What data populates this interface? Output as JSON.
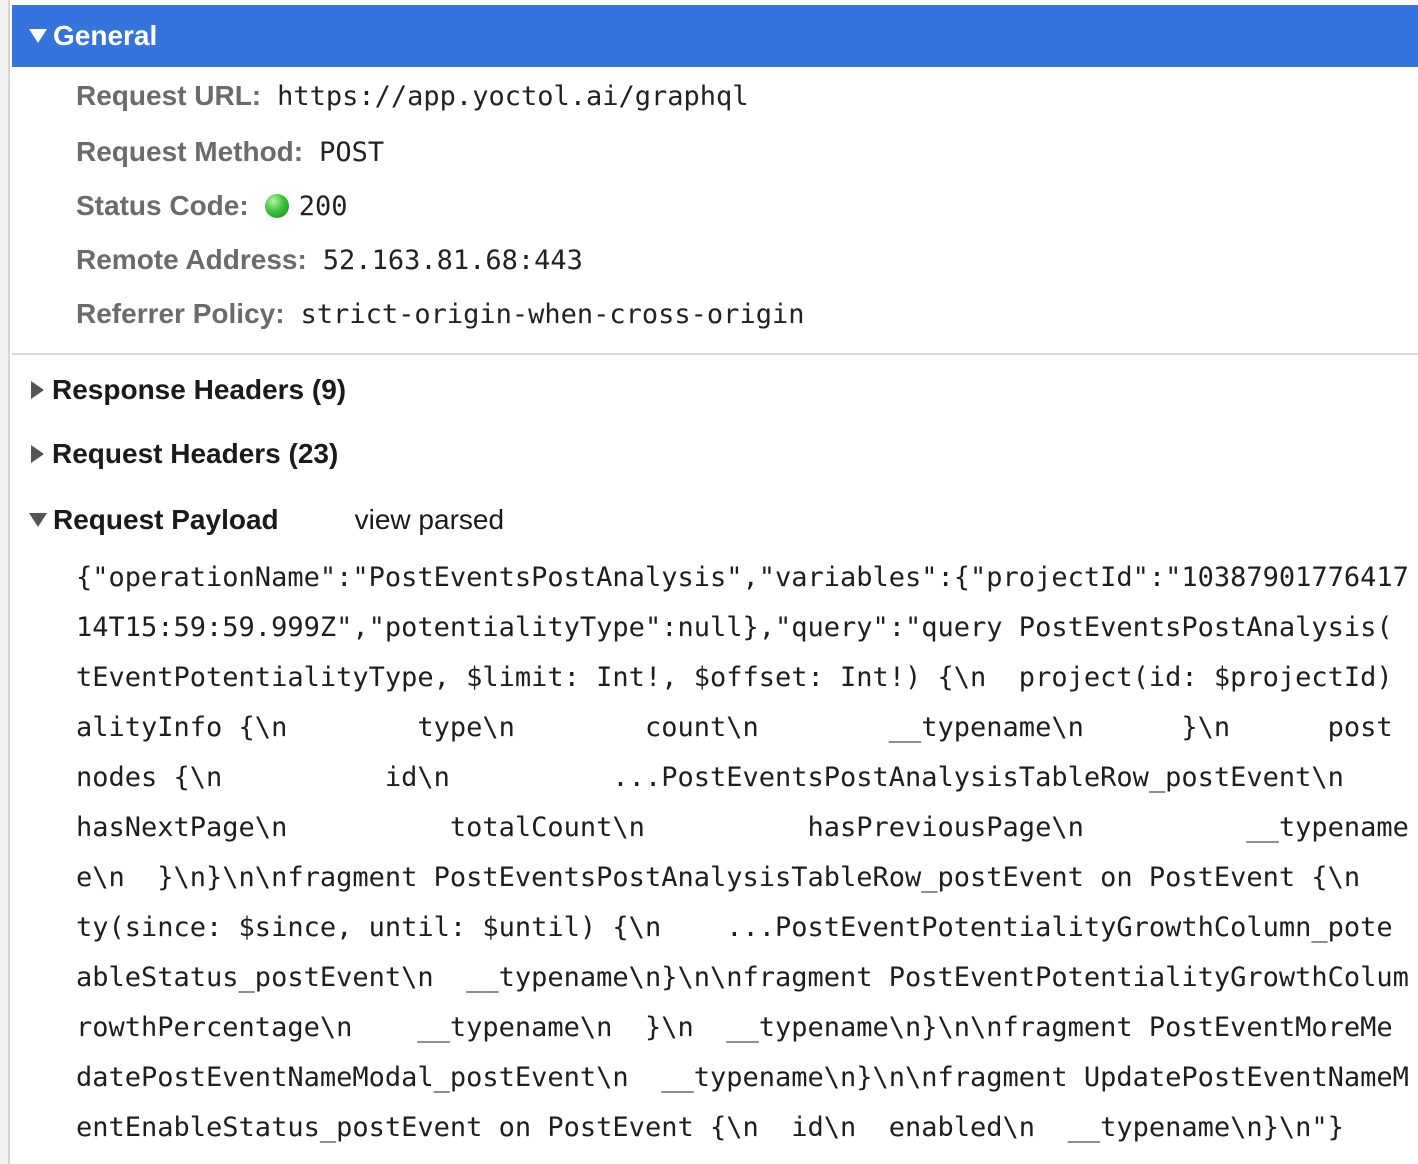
{
  "general": {
    "title": "General",
    "fields": [
      {
        "label": "Request URL:",
        "value": "https://app.yoctol.ai/graphql"
      },
      {
        "label": "Request Method:",
        "value": "POST"
      },
      {
        "label": "Status Code:",
        "value": "200"
      },
      {
        "label": "Remote Address:",
        "value": "52.163.81.68:443"
      },
      {
        "label": "Referrer Policy:",
        "value": "strict-origin-when-cross-origin"
      }
    ],
    "status_color": "#33b833",
    "header_color": "#3574dd"
  },
  "sections": {
    "response_headers": "Response Headers (9)",
    "request_headers": "Request Headers (23)",
    "request_payload": "Request Payload",
    "view_parsed": "view parsed"
  },
  "payload": {
    "lines": [
      "{\"operationName\":\"PostEventsPostAnalysis\",\"variables\":{\"projectId\":\"10387901776417",
      "14T15:59:59.999Z\",\"potentialityType\":null},\"query\":\"query PostEventsPostAnalysis(",
      "tEventPotentialityType, $limit: Int!, $offset: Int!) {\\n  project(id: $projectId)",
      "alityInfo {\\n        type\\n        count\\n        __typename\\n      }\\n      post",
      "nodes {\\n          id\\n          ...PostEventsPostAnalysisTableRow_postEvent\\n",
      "hasNextPage\\n          totalCount\\n          hasPreviousPage\\n          __typename",
      "e\\n  }\\n}\\n\\nfragment PostEventsPostAnalysisTableRow_postEvent on PostEvent {\\n",
      "ty(since: $since, until: $until) {\\n    ...PostEventPotentialityGrowthColumn_pote",
      "ableStatus_postEvent\\n  __typename\\n}\\n\\nfragment PostEventPotentialityGrowthColum",
      "rowthPercentage\\n    __typename\\n  }\\n  __typename\\n}\\n\\nfragment PostEventMoreMe",
      "datePostEventNameModal_postEvent\\n  __typename\\n}\\n\\nfragment UpdatePostEventNameM",
      "entEnableStatus_postEvent on PostEvent {\\n  id\\n  enabled\\n  __typename\\n}\\n\"}"
    ]
  }
}
